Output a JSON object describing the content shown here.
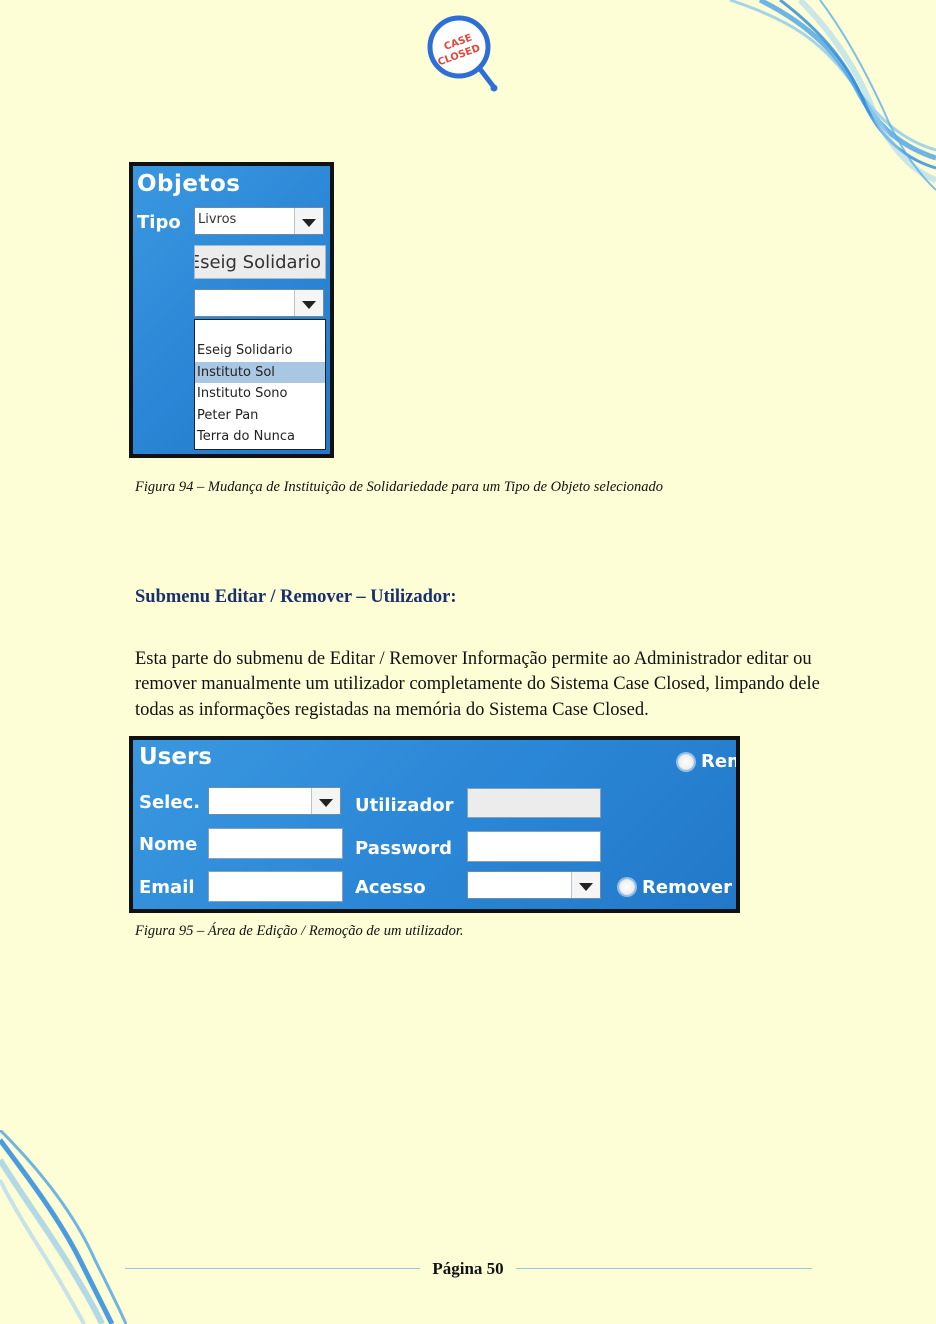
{
  "logo": {
    "line1": "CASE",
    "line2": "CLOSED",
    "accent": "#2e6fd6",
    "text_color": "#e2463c"
  },
  "figure94": {
    "title": "Objetos",
    "tipo_label": "Tipo",
    "tipo_value": "Livros",
    "institution_button": "Eseig Solidario",
    "dropdown_items": [
      "Eseig Solidario",
      "Instituto Sol",
      "Instituto Sono",
      "Peter Pan",
      "Terra do Nunca"
    ],
    "highlighted_item": "Instituto Sol",
    "caption": "Figura 94 – Mudança de Instituição de Solidariedade para um Tipo de Objeto selecionado"
  },
  "section": {
    "heading": "Submenu Editar / Remover – Utilizador:",
    "paragraph": "Esta parte do submenu de Editar / Remover Informação permite ao Administrador editar ou remover manualmente um utilizador completamente do Sistema Case Closed, limpando dele todas as informações registadas na memória do Sistema Case Closed."
  },
  "figure95": {
    "title": "Users",
    "top_radio_label": "Rem",
    "labels": {
      "selec": "Selec.",
      "nome": "Nome",
      "email": "Email",
      "utilizador": "Utilizador",
      "password": "Password",
      "acesso": "Acesso"
    },
    "remover_label": "Remover",
    "caption": "Figura 95 – Área de Edição / Remoção de um utilizador."
  },
  "footer": {
    "page_label": "Página 50"
  },
  "colors": {
    "page_bg": "#fefed6",
    "panel_blue": "#2a86d6",
    "heading_navy": "#1b2e6e",
    "footer_rule": "#9cc4de"
  }
}
